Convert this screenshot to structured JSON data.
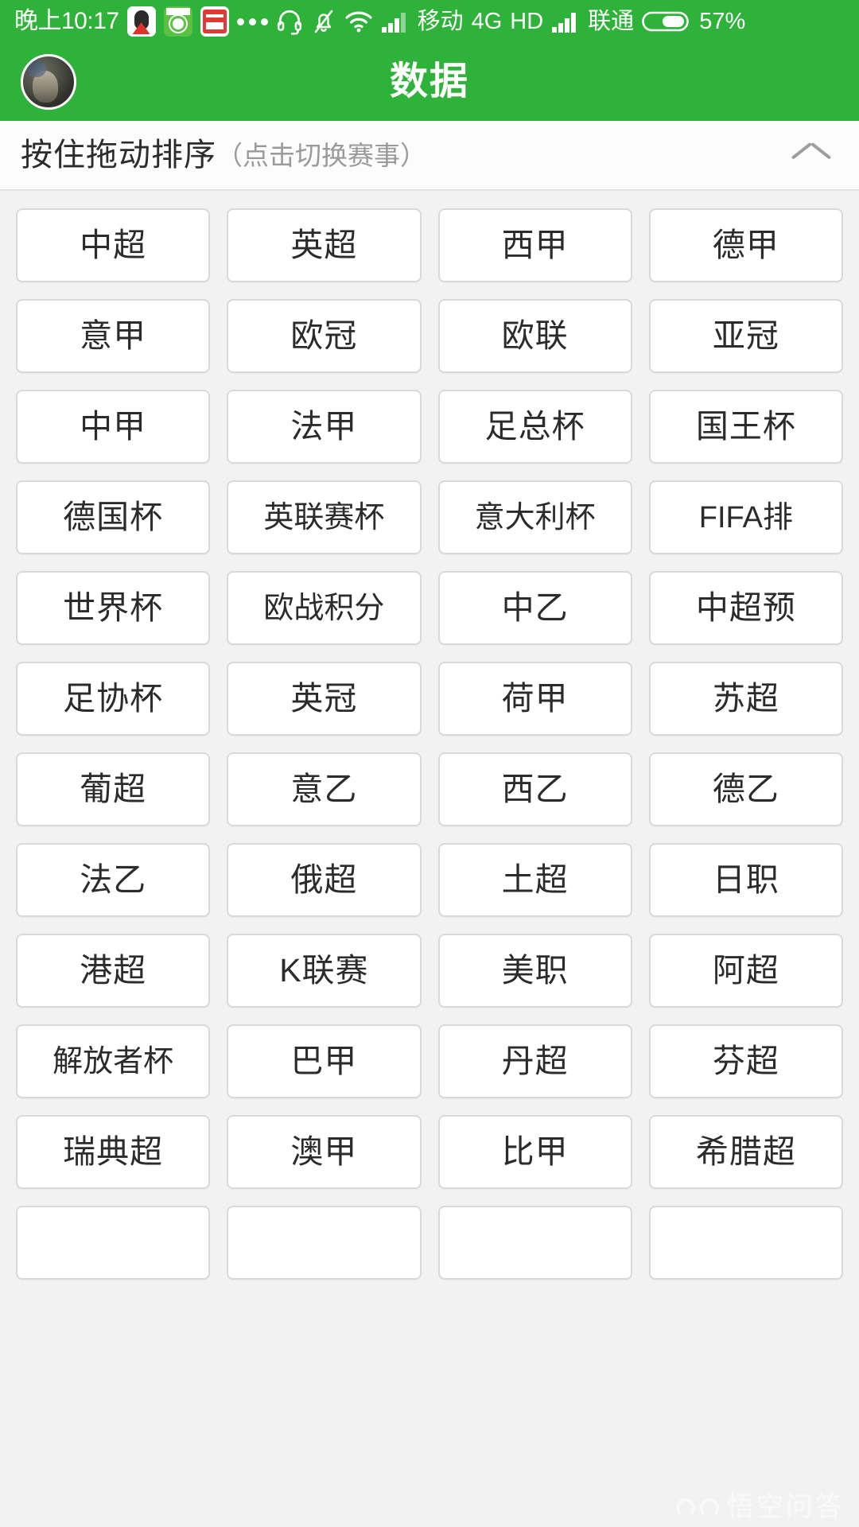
{
  "status_bar": {
    "time": "晚上10:17",
    "icons": [
      "qq-icon",
      "green-app-icon",
      "toutiao-icon",
      "more-dots-icon",
      "headset-icon",
      "bell-muted-icon",
      "wifi-icon",
      "signal-bars-icon"
    ],
    "carrier_primary": "移动",
    "network_type": "4G",
    "hd_label": "HD",
    "carrier_secondary": "联通",
    "battery_percent": "57%",
    "background_color": "#2eb239"
  },
  "app_bar": {
    "title": "数据",
    "avatar_name": "user-avatar",
    "background_color": "#2eb239"
  },
  "section_header": {
    "title": "按住拖动排序",
    "hint": "（点击切换赛事）",
    "collapse_icon": "chevron-up-icon"
  },
  "leagues": [
    "中超",
    "英超",
    "西甲",
    "德甲",
    "意甲",
    "欧冠",
    "欧联",
    "亚冠",
    "中甲",
    "法甲",
    "足总杯",
    "国王杯",
    "德国杯",
    "英联赛杯",
    "意大利杯",
    "FIFA排",
    "世界杯",
    "欧战积分",
    "中乙",
    "中超预",
    "足协杯",
    "英冠",
    "荷甲",
    "苏超",
    "葡超",
    "意乙",
    "西乙",
    "德乙",
    "法乙",
    "俄超",
    "土超",
    "日职",
    "港超",
    "K联赛",
    "美职",
    "阿超",
    "解放者杯",
    "巴甲",
    "丹超",
    "芬超",
    "瑞典超",
    "澳甲",
    "比甲",
    "希腊超",
    "",
    "",
    "",
    ""
  ],
  "watermark": {
    "text": "悟空问答",
    "logo": "wukong-logo-icon"
  },
  "colors": {
    "brand_green": "#2eb239",
    "page_background": "#f2f2f2",
    "tile_background": "#ffffff",
    "tile_border": "#d9d9d9",
    "text_primary": "#2b2b2b",
    "text_muted": "#9a9a9a"
  }
}
